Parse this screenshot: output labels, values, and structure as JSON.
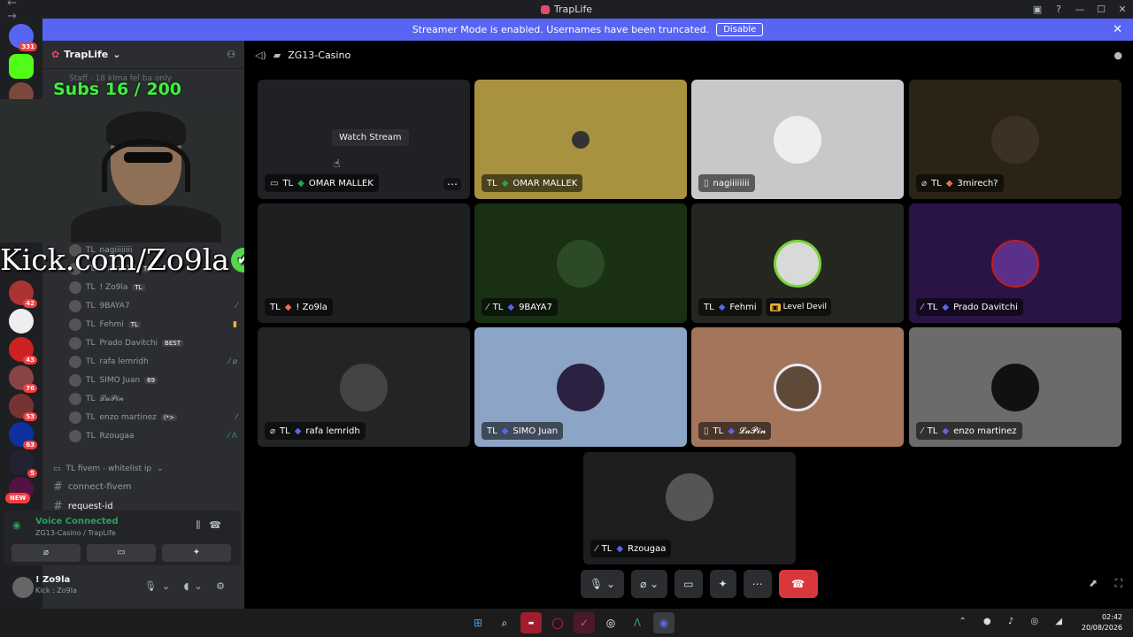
{
  "window": {
    "title": "TrapLife",
    "nav": "← →",
    "win_buttons": [
      "▣",
      "?",
      "—",
      "☐",
      "✕"
    ]
  },
  "banner": {
    "text": "Streamer Mode is enabled. Usernames have been truncated.",
    "button": "Disable",
    "close": "✕"
  },
  "servers": {
    "badges": [
      "331",
      "42",
      "43",
      "76",
      "53",
      "63",
      "5",
      "NEW"
    ]
  },
  "channels": {
    "server_name": "TrapLife",
    "partial_top": "Staff · 18 klma fel ba only",
    "members": [
      {
        "prefix": "TL",
        "name": "nagiiiiiiii",
        "tag": "",
        "right": ""
      },
      {
        "prefix": "TL",
        "name": "3mirech?",
        "tag": "TL",
        "right": ""
      },
      {
        "prefix": "TL",
        "name": "! Zo9la",
        "tag": "TL",
        "right": ""
      },
      {
        "prefix": "TL",
        "name": "9BAYA7",
        "tag": "",
        "right": "⁄"
      },
      {
        "prefix": "TL",
        "name": "Fehmi",
        "tag": "TL",
        "right": "▮"
      },
      {
        "prefix": "TL",
        "name": "Prado Davitchi",
        "tag": "BEST",
        "right": ""
      },
      {
        "prefix": "TL",
        "name": "rafa lemridh",
        "tag": "",
        "right": "⁄ ⌀"
      },
      {
        "prefix": "TL",
        "name": "SIMO Juan",
        "tag": "69",
        "right": ""
      },
      {
        "prefix": "TL",
        "name": "𝓛𝓪𝓟𝓲𝓷",
        "tag": "",
        "right": ""
      },
      {
        "prefix": "TL",
        "name": "enzo martinez",
        "tag": "(*>",
        "right": "⁄"
      },
      {
        "prefix": "TL",
        "name": "Rzougaa",
        "tag": "",
        "right": "⁄ Λ"
      }
    ],
    "category": "TL fivem - whitelist ip",
    "channel_items": [
      "connect-fivem",
      "request-id"
    ]
  },
  "voice": {
    "status": "Voice Connected",
    "location": "ZG13-Casino / TrapLife",
    "btn_video": "⌀",
    "btn_screen": "▭",
    "btn_activity": "✦"
  },
  "user": {
    "name": "! Zo9la",
    "status": "Kick : Zo9la"
  },
  "overlay": {
    "subs": "Subs 16 / 200",
    "kick": "Kick.com/Zo9la",
    "check": "✔"
  },
  "main": {
    "channel": "ZG13-Casino",
    "watch_stream": "Watch Stream"
  },
  "tiles": [
    {
      "prefix": "TL",
      "name": "OMAR MALLEK",
      "bg": "#1f2124",
      "ic": "▭",
      "extra": ""
    },
    {
      "prefix": "TL",
      "name": "OMAR MALLEK",
      "bg": "#a8923f",
      "ic": "",
      "extra": ""
    },
    {
      "prefix": "",
      "name": "nagiiiiiiii",
      "bg": "#c8c8c8",
      "ic": "▯",
      "extra": ""
    },
    {
      "prefix": "TL",
      "name": "3mirech?",
      "bg": "#2b2316",
      "ic": "⌀",
      "extra": ""
    },
    {
      "prefix": "TL",
      "name": "! Zo9la",
      "bg": "#1e1f20",
      "ic": "",
      "extra": ""
    },
    {
      "prefix": "TL",
      "name": "9BAYA7",
      "bg": "#1a3014",
      "ic": "⁄",
      "extra": ""
    },
    {
      "prefix": "TL",
      "name": "Fehmi",
      "bg": "#25261f",
      "ic": "",
      "extra": "Level Devil"
    },
    {
      "prefix": "TL",
      "name": "Prado Davitchi",
      "bg": "#2a1446",
      "ic": "⁄",
      "extra": ""
    },
    {
      "prefix": "TL",
      "name": "rafa lemridh",
      "bg": "#232425",
      "ic": "⌀",
      "extra": ""
    },
    {
      "prefix": "TL",
      "name": "SIMO Juan",
      "bg": "#8ca4c6",
      "ic": "",
      "extra": ""
    },
    {
      "prefix": "TL",
      "name": "𝓛𝓪𝓟𝓲𝓷",
      "bg": "#a3755b",
      "ic": "▯",
      "extra": ""
    },
    {
      "prefix": "TL",
      "name": "enzo martinez",
      "bg": "#6b6b6b",
      "ic": "⁄",
      "extra": ""
    },
    {
      "prefix": "TL",
      "name": "Rzougaa",
      "bg": "#1d1e20",
      "ic": "⁄",
      "extra": ""
    }
  ],
  "controls": {
    "mic": "🎙 ⌄",
    "cam": "⌀ ⌄",
    "screen": "▭",
    "activity": "✦",
    "more": "⋯",
    "hangup": "☎"
  },
  "taskbar": {
    "time": "02:42",
    "date": "20/08/2026",
    "tray": "⌃ ● ♪ ◎ ◢"
  }
}
